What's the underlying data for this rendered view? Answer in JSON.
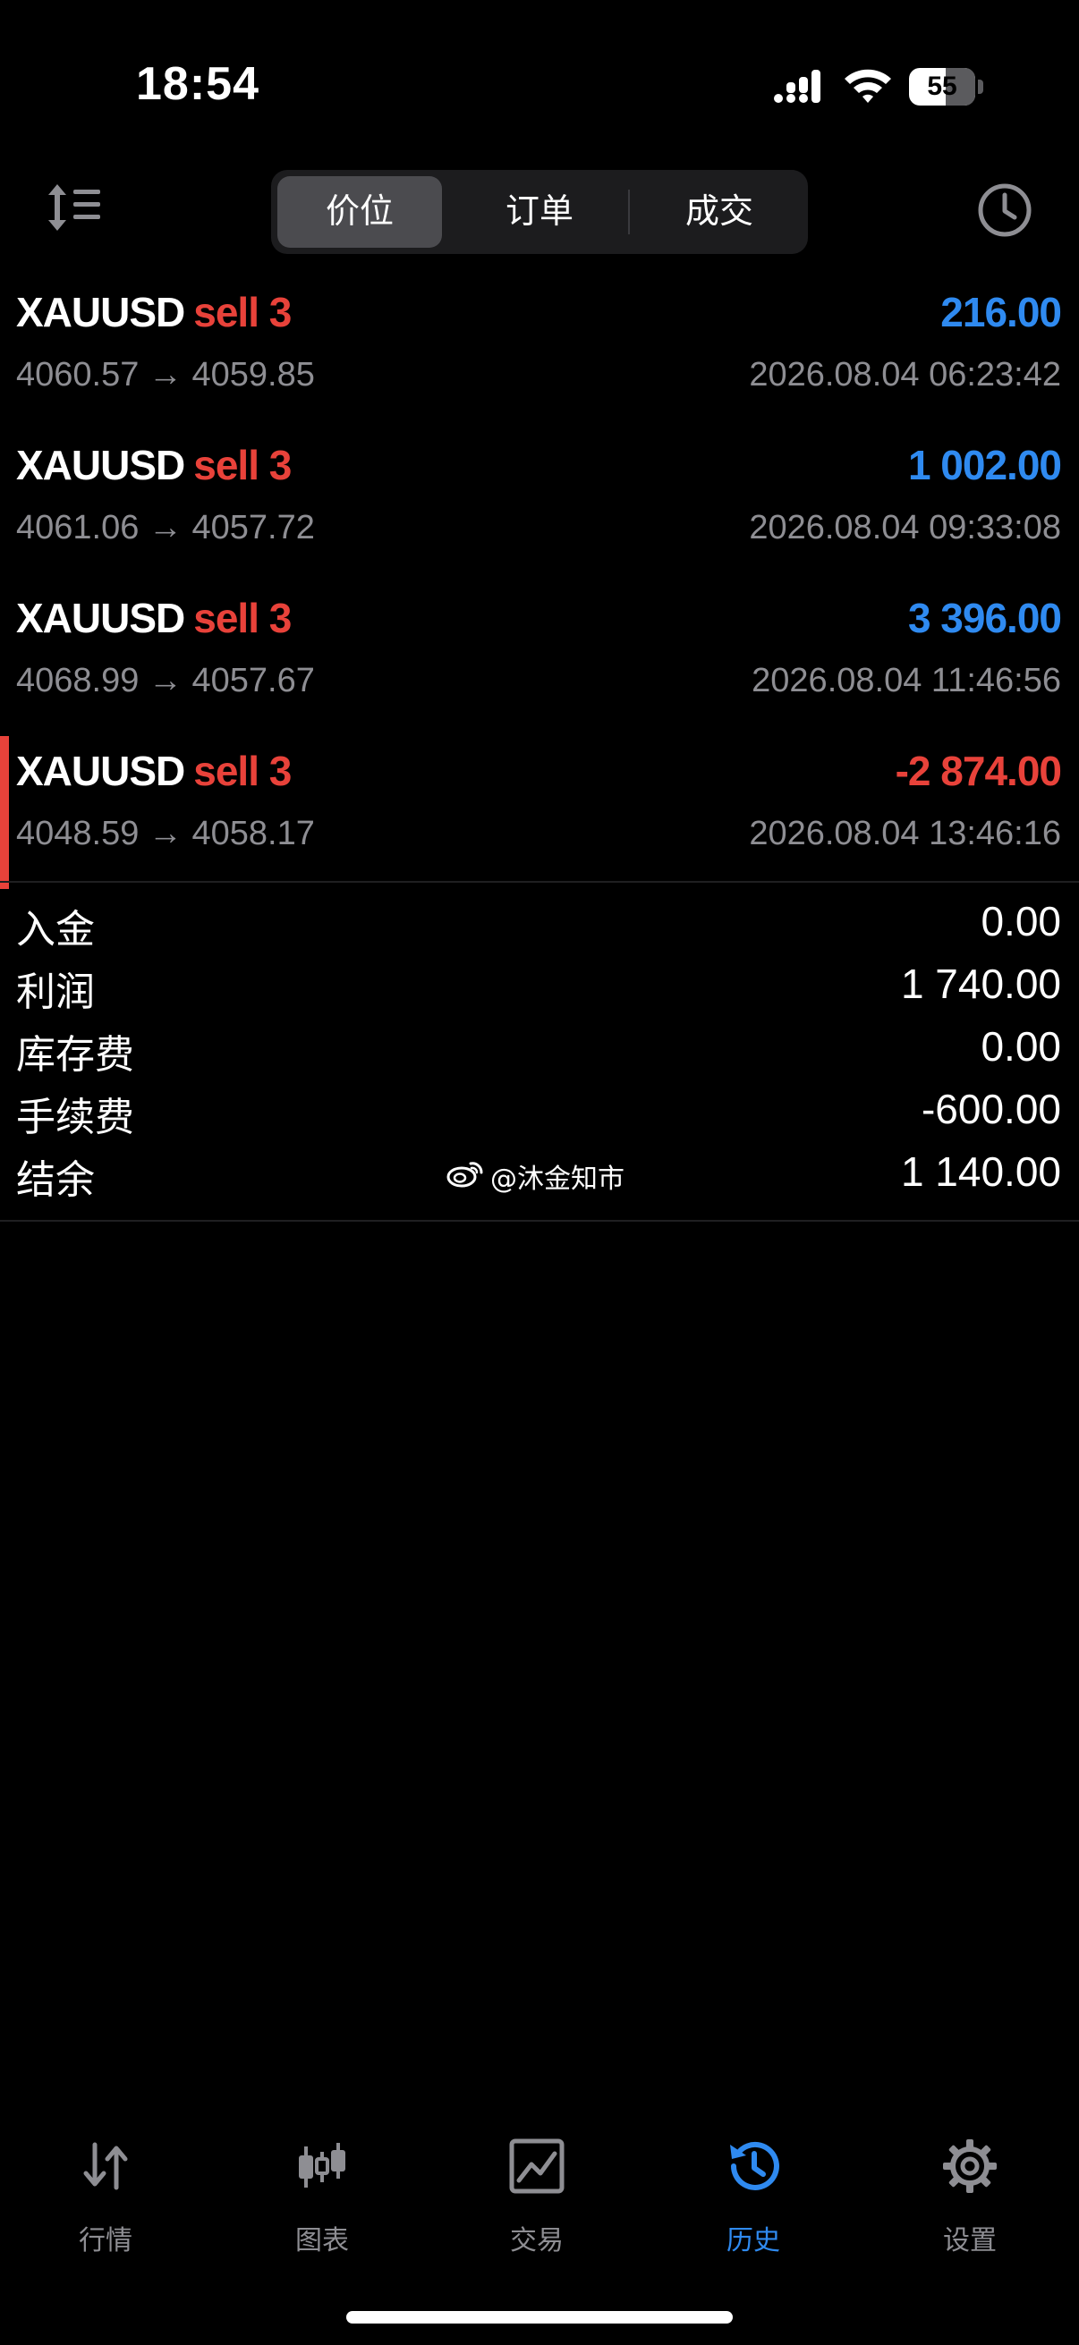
{
  "status_bar": {
    "time": "18:54",
    "battery": "55",
    "battery_level": 0.55
  },
  "toolbar": {
    "segments": [
      {
        "label": "价位",
        "active": true
      },
      {
        "label": "订单",
        "active": false
      },
      {
        "label": "成交",
        "active": false
      }
    ]
  },
  "deals": [
    {
      "symbol": "XAUUSD",
      "side": "sell 3",
      "profit": "216.00",
      "prices": "4060.57 → 4059.85",
      "time": "2026.08.04 06:23:42",
      "positive": true
    },
    {
      "symbol": "XAUUSD",
      "side": "sell 3",
      "profit": "1 002.00",
      "prices": "4061.06 → 4057.72",
      "time": "2026.08.04 09:33:08",
      "positive": true
    },
    {
      "symbol": "XAUUSD",
      "side": "sell 3",
      "profit": "3 396.00",
      "prices": "4068.99 → 4057.67",
      "time": "2026.08.04 11:46:56",
      "positive": true
    },
    {
      "symbol": "XAUUSD",
      "side": "sell 3",
      "profit": "-2 874.00",
      "prices": "4048.59 → 4058.17",
      "time": "2026.08.04 13:46:16",
      "positive": false
    }
  ],
  "summary": [
    {
      "label": "入金",
      "value": "0.00"
    },
    {
      "label": "利润",
      "value": "1 740.00"
    },
    {
      "label": "库存费",
      "value": "0.00"
    },
    {
      "label": "手续费",
      "value": "-600.00"
    },
    {
      "label": "结余",
      "value": "1 140.00"
    }
  ],
  "watermark": "@沐金知市",
  "tabs": [
    {
      "label": "行情",
      "icon": "quotes-arrows-icon",
      "active": false
    },
    {
      "label": "图表",
      "icon": "candlestick-chart-icon",
      "active": false
    },
    {
      "label": "交易",
      "icon": "trade-chart-icon",
      "active": false
    },
    {
      "label": "历史",
      "icon": "history-icon",
      "active": true
    },
    {
      "label": "设置",
      "icon": "gear-icon",
      "active": false
    }
  ],
  "colors": {
    "profit_positive": "#2f8af0",
    "profit_negative": "#e8423a",
    "side_sell": "#e8423a",
    "tab_active": "#2f8af0",
    "tab_inactive": "#8e8e93"
  }
}
